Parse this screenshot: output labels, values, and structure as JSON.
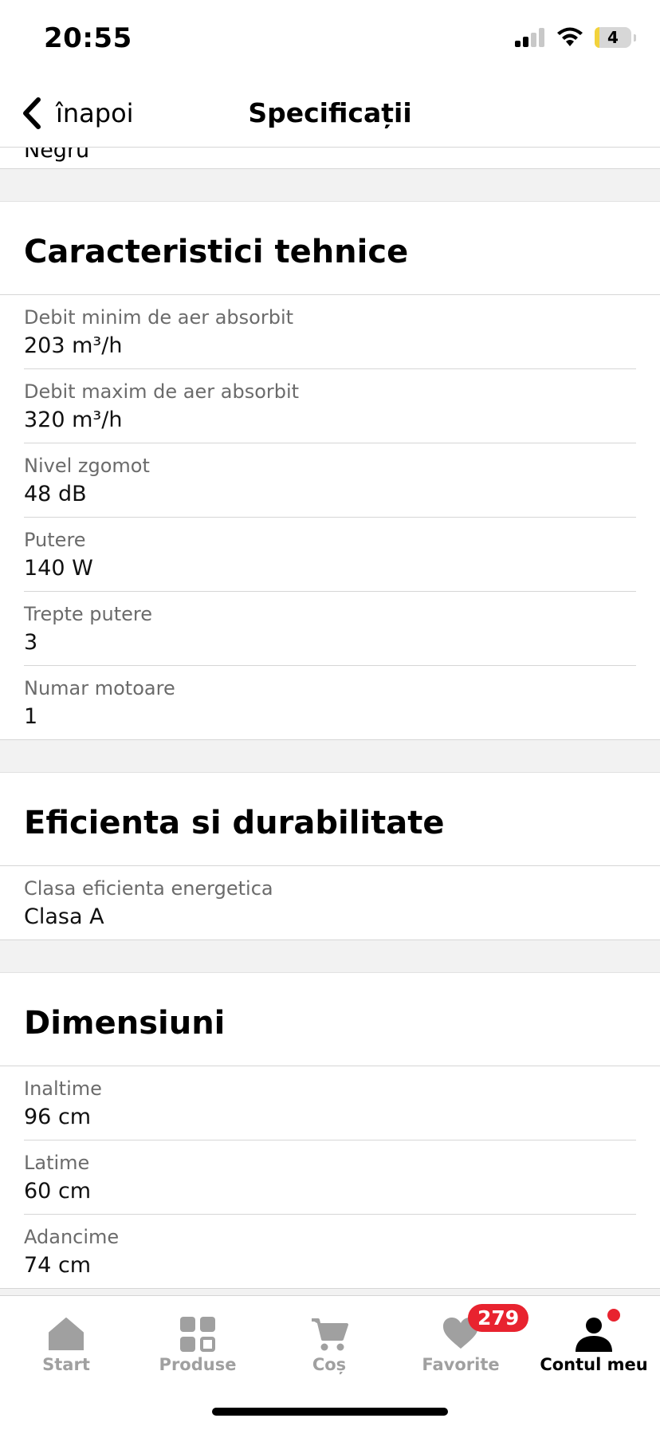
{
  "status_bar": {
    "time": "20:55",
    "battery_level": "4"
  },
  "nav": {
    "back_label": "înapoi",
    "title": "Specificații"
  },
  "partial_value": "Negru",
  "sections": [
    {
      "title": "Caracteristici tehnice",
      "rows": [
        {
          "label": "Debit minim de aer absorbit",
          "value": "203 m³/h"
        },
        {
          "label": "Debit maxim de aer absorbit",
          "value": "320 m³/h"
        },
        {
          "label": "Nivel zgomot",
          "value": "48 dB"
        },
        {
          "label": "Putere",
          "value": "140 W"
        },
        {
          "label": "Trepte putere",
          "value": "3"
        },
        {
          "label": "Numar motoare",
          "value": "1"
        }
      ]
    },
    {
      "title": "Eficienta si durabilitate",
      "rows": [
        {
          "label": "Clasa eficienta energetica",
          "value": "Clasa A"
        }
      ]
    },
    {
      "title": "Dimensiuni",
      "rows": [
        {
          "label": "Inaltime",
          "value": "96 cm"
        },
        {
          "label": "Latime",
          "value": "60 cm"
        },
        {
          "label": "Adancime",
          "value": "74 cm"
        }
      ]
    }
  ],
  "tabs": [
    {
      "label": "Start",
      "icon": "home-icon"
    },
    {
      "label": "Produse",
      "icon": "grid-icon"
    },
    {
      "label": "Coș",
      "icon": "cart-icon"
    },
    {
      "label": "Favorite",
      "icon": "heart-icon",
      "badge": "279"
    },
    {
      "label": "Contul meu",
      "icon": "user-icon",
      "active": true
    }
  ],
  "colors": {
    "accent": "#e8232f",
    "inactive": "#a0a0a0",
    "section_gap": "#f2f2f2"
  }
}
